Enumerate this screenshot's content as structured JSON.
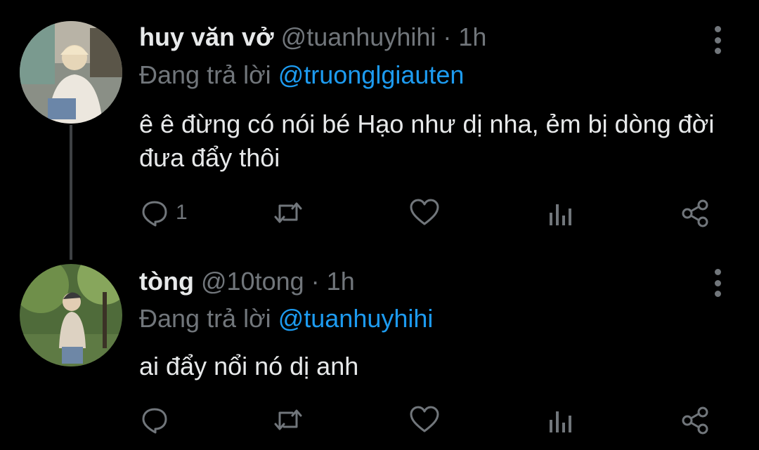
{
  "tweets": [
    {
      "name": "huy văn vở",
      "handle": "@tuanhuyhihi",
      "separator": "·",
      "time": "1h",
      "reply_prefix": "Đang trả lời",
      "reply_to": "@truonglgiauten",
      "text": "ê ê đừng có nói bé Hạo như dị nha, ẻm bị dòng đời đưa đẩy thôi",
      "reply_count": "1",
      "icons": [
        "reply-icon",
        "retweet-icon",
        "like-icon",
        "analytics-icon",
        "share-icon",
        "more-icon"
      ]
    },
    {
      "name": "tòng",
      "handle": "@10tong",
      "separator": "·",
      "time": "1h",
      "reply_prefix": "Đang trả lời",
      "reply_to": "@tuanhuyhihi",
      "text": "ai đẩy nổi nó dị anh",
      "reply_count": "",
      "icons": [
        "reply-icon",
        "retweet-icon",
        "like-icon",
        "analytics-icon",
        "share-icon",
        "more-icon"
      ]
    }
  ],
  "colors": {
    "background": "#000000",
    "text": "#e7e9ea",
    "muted": "#71767b",
    "accent": "#1d9bf0",
    "thread": "#3e4144"
  }
}
